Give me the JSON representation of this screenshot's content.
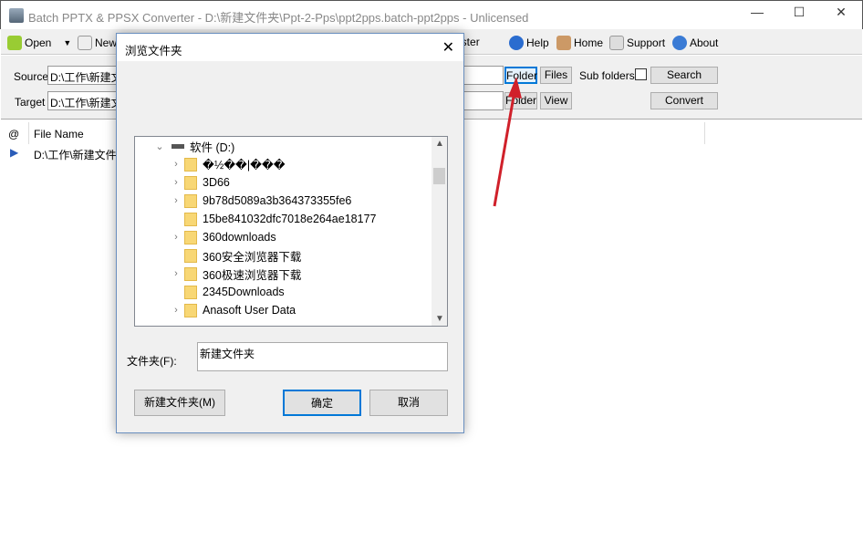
{
  "window": {
    "title": "Batch PPTX & PPSX Converter - D:\\新建文件夹\\Ppt-2-Pps\\ppt2pps.batch-ppt2pps - Unlicensed",
    "min": "—",
    "max": "☐",
    "close": "✕"
  },
  "toolbar": {
    "open": "Open",
    "new": "New",
    "register": "Register",
    "help": "Help",
    "home": "Home",
    "support": "Support",
    "about": "About"
  },
  "panel": {
    "source_label": "Source",
    "source_value": "D:\\工作\\新建文",
    "target_label": "Target",
    "target_value": "D:\\工作\\新建文",
    "folder": "Folder",
    "files": "Files",
    "subfolders": "Sub folders",
    "search": "Search",
    "folder2": "Folder",
    "view": "View",
    "convert": "Convert"
  },
  "list": {
    "col_at": "@",
    "col_name": "File Name",
    "rows": [
      {
        "name": "D:\\工作\\新建文件"
      }
    ]
  },
  "dialog": {
    "title": "浏览文件夹",
    "close": "✕",
    "tree": {
      "root": "软件 (D:)",
      "items": [
        {
          "name": "�½��|���",
          "expandable": true
        },
        {
          "name": "3D66",
          "expandable": true
        },
        {
          "name": "9b78d5089a3b364373355fe6",
          "expandable": true
        },
        {
          "name": "15be841032dfc7018e264ae18177",
          "expandable": false
        },
        {
          "name": "360downloads",
          "expandable": true
        },
        {
          "name": "360安全浏览器下载",
          "expandable": false
        },
        {
          "name": "360极速浏览器下载",
          "expandable": true
        },
        {
          "name": "2345Downloads",
          "expandable": false
        },
        {
          "name": "Anasoft User Data",
          "expandable": true
        }
      ]
    },
    "folder_label": "文件夹(F):",
    "folder_value": "新建文件夹",
    "new_folder": "新建文件夹(M)",
    "ok": "确定",
    "cancel": "取消"
  },
  "colors": {
    "accent": "#0078d7",
    "arrow": "#d0202a"
  }
}
